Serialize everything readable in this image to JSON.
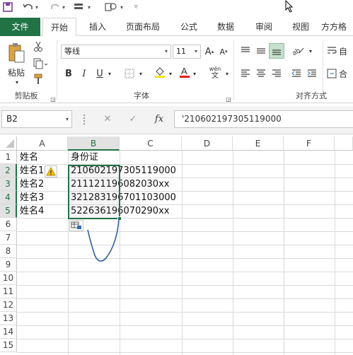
{
  "ribbon": {
    "tabs": [
      "文件",
      "开始",
      "插入",
      "页面布局",
      "公式",
      "数据",
      "审阅",
      "视图",
      "方方格"
    ],
    "font_name": "等线",
    "font_size": "11",
    "grow_font": "A",
    "shrink_font": "A",
    "bold": "B",
    "italic": "I",
    "underline": "U",
    "paste_label": "粘贴",
    "clipboard_group": "剪贴板",
    "font_group": "字体",
    "align_group": "对齐方式",
    "phonetic": "wén",
    "phonetic_sub": "文",
    "auto_label": "自",
    "merge_label": "合"
  },
  "formula_bar": {
    "name_box": "B2",
    "cancel": "✕",
    "enter": "✓",
    "fx": "fx",
    "formula": "'210602197305119000"
  },
  "grid": {
    "columns": [
      "A",
      "B",
      "C",
      "D",
      "E",
      "F"
    ],
    "rows": [
      "1",
      "2",
      "3",
      "4",
      "5",
      "6",
      "7",
      "8",
      "9",
      "10",
      "11",
      "12",
      "13",
      "14",
      "15"
    ],
    "cells": {
      "A1": "姓名",
      "B1": "身份证",
      "A2": "姓名1",
      "A3": "姓名2",
      "A4": "姓名3",
      "A5": "姓名4",
      "B2": "210602197305119000",
      "B3": "211121196082030xx",
      "B4": "321283196701103000",
      "B5": "522636196070290xx"
    }
  },
  "colors": {
    "accent": "#217346",
    "cell_text": "#111111"
  }
}
